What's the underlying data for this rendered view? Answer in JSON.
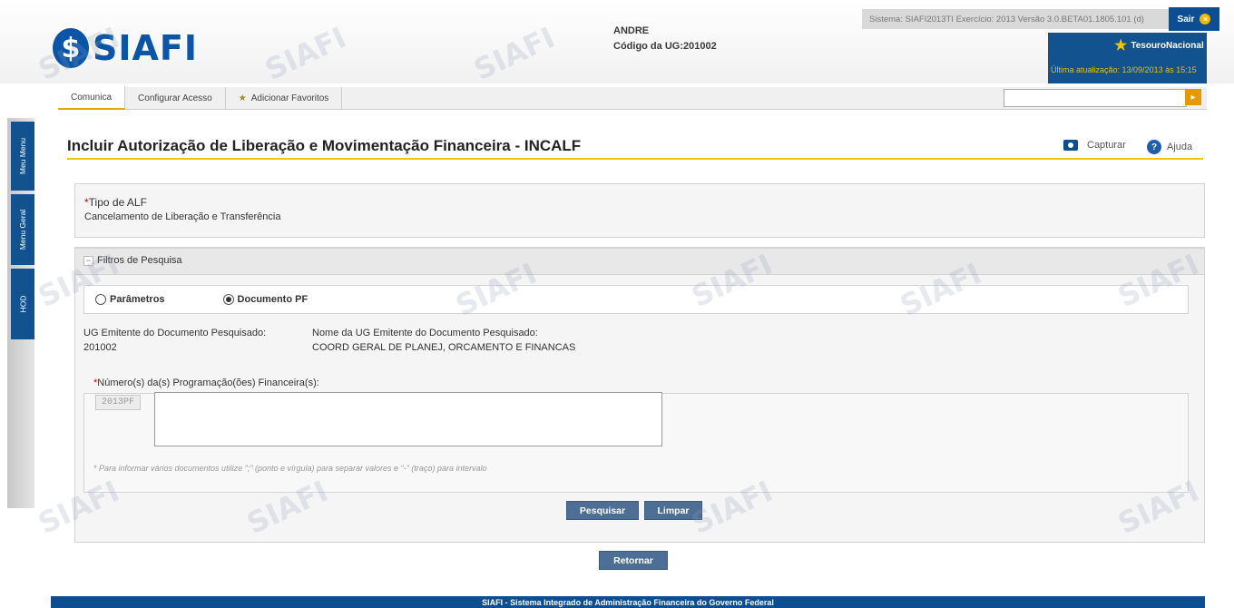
{
  "header": {
    "logo_text": "SIAFI",
    "user_name": "ANDRE",
    "ug_label": "Código da UG:",
    "ug_code": "201002",
    "system_info": "Sistema: SIAFI2013TI  Exercício: 2013  Versão 3.0.BETA01.1805.101 (d)",
    "exit_label": "Sair",
    "brand": "TesouroNacional",
    "last_update": "Última atualização: 13/09/2013 às 15:15"
  },
  "menu": {
    "items": [
      "Comunica",
      "Configurar Acesso",
      "Adicionar Favoritos"
    ],
    "search_value": ""
  },
  "sidebar": {
    "tabs": [
      "Meu Menu",
      "Menu Geral",
      "HOD"
    ]
  },
  "page": {
    "title": "Incluir Autorização de Liberação e Movimentação Financeira - INCALF",
    "capture_label": "Capturar",
    "help_label": "Ajuda"
  },
  "tipo": {
    "label": "Tipo de ALF",
    "value": "Cancelamento de Liberação e Transferência"
  },
  "filtros": {
    "title": "Filtros de Pesquisa",
    "option_params": "Parâmetros",
    "option_doc": "Documento PF",
    "selected": "Documento PF",
    "ug_emitente_label": "UG Emitente do Documento Pesquisado:",
    "ug_emitente_value": "201002",
    "nome_ug_label": "Nome da UG Emitente do Documento Pesquisado:",
    "nome_ug_value": "COORD GERAL DE PLANEJ, ORCAMENTO E FINANCAS",
    "numeros_label": "Número(s) da(s) Programação(ões) Financeira(s):",
    "prefix": "2013PF",
    "numeros_value": "",
    "hint": "* Para informar vários documentos utilize \";\" (ponto e vírgula) para separar valores e \"-\" (traço) para intervalo"
  },
  "buttons": {
    "pesquisar": "Pesquisar",
    "limpar": "Limpar",
    "retornar": "Retornar"
  },
  "footer": {
    "text": "SIAFI - Sistema Integrado de Administração Financeira do Governo Federal"
  },
  "colors": {
    "brand_blue": "#0d4e93",
    "accent_yellow": "#f0c40a",
    "button": "#4d6f95",
    "required": "#d40000"
  }
}
